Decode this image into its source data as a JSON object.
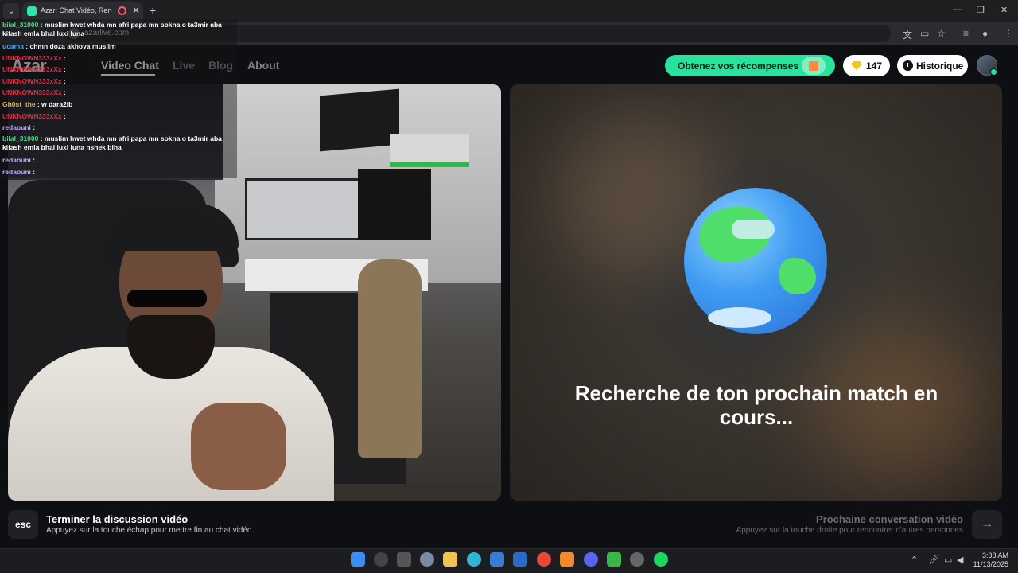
{
  "browser": {
    "tab_title": "Azar: Chat Vidéo, Rencontr",
    "url": "azarlive.com"
  },
  "nav": {
    "logo": "Azar",
    "links": [
      "Video Chat",
      "Live",
      "Blog",
      "About"
    ],
    "rewards_label": "Obtenez vos récompenses !",
    "gems_count": "147",
    "history_label": "Historique"
  },
  "match": {
    "searching_text": "Recherche de ton prochain match en cours..."
  },
  "footer": {
    "esc_key": "esc",
    "end_title": "Terminer la discussion vidéo",
    "end_sub": "Appuyez sur la touche échap pour mettre fin au chat vidéo.",
    "next_title": "Prochaine conversation vidéo",
    "next_sub": "Appuyez sur la touche droite pour rencontrer d'autres personnes",
    "next_key": "→"
  },
  "taskbar": {
    "time": "3:38 AM",
    "date": "11/13/2025"
  },
  "chat": [
    {
      "user": "bilal_31000",
      "msg": "muslim hwet whda mn afri papa mn sokna o ta3mir aba kifash emla bhal luxi luna",
      "color": "#4fd38a"
    },
    {
      "user": "ucama",
      "msg": "chmn doza akhoya muslim",
      "color": "#4aa8ff"
    },
    {
      "user": "UNKNOWN333xXx",
      "msg": "",
      "color": "#e0304a"
    },
    {
      "user": "UNKNOWN333xXx",
      "msg": "",
      "color": "#e0304a"
    },
    {
      "user": "UNKNOWN333xXx",
      "msg": "",
      "color": "#e0304a"
    },
    {
      "user": "UNKNOWN333xXx",
      "msg": "",
      "color": "#e0304a"
    },
    {
      "user": "Gh0st_the",
      "msg": "w dara2ib",
      "color": "#e6b04a"
    },
    {
      "user": "UNKNOWN333xXx",
      "msg": "",
      "color": "#e0304a"
    },
    {
      "user": "redaouni",
      "msg": "",
      "color": "#c8a8ff"
    },
    {
      "user": "bilal_31000",
      "msg": "muslim hwet whda mn afri papa mn sokna o ta3mir aba kifash emla bhal luxi luna nshek biha",
      "color": "#4fd38a"
    },
    {
      "user": "redaouni",
      "msg": "",
      "color": "#c8a8ff"
    },
    {
      "user": "redaouni",
      "msg": "",
      "color": "#c8a8ff"
    }
  ]
}
